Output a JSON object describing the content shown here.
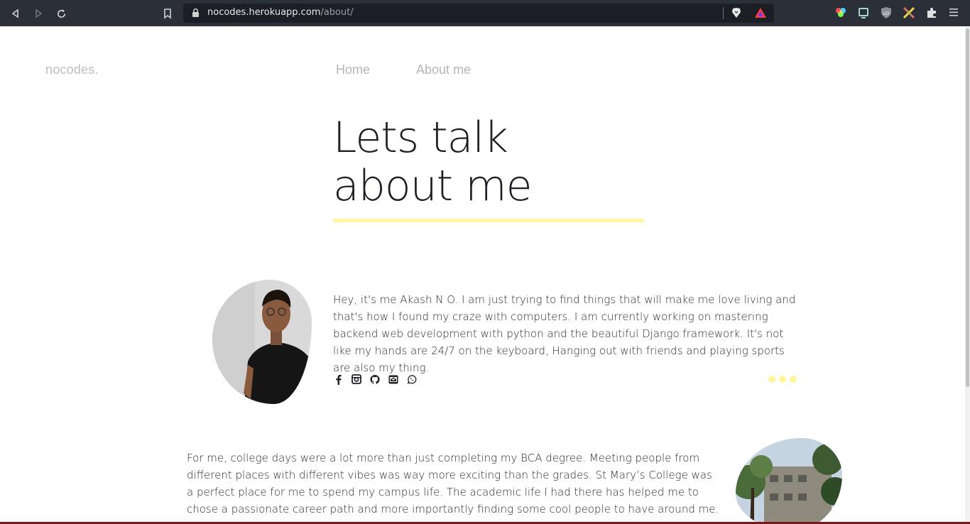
{
  "browser": {
    "url_host": "nocodes.herokuapp.com",
    "url_path": "/about/"
  },
  "site": {
    "logo": "nocodes.",
    "nav": [
      {
        "label": "Home"
      },
      {
        "label": "About me"
      }
    ]
  },
  "hero": {
    "line1": "Lets talk",
    "line2": "about me"
  },
  "about": {
    "bio": "Hey, it's me Akash N O. I am just trying to find things that will make me love living and that's how I found my craze with computers. I am currently working on mastering backend web development with python and the beautiful Django framework. It's not like my hands are 24/7 on the keyboard, Hanging out with friends and playing sports are also my thing.",
    "socials": [
      "facebook-icon",
      "instagram-icon",
      "github-icon",
      "email-icon",
      "whatsapp-icon"
    ]
  },
  "college": {
    "text": "For me, college days were a lot more than just completing my BCA degree. Meeting people from different places with different vibes was way more exciting than the grades. St Mary’s College was a perfect place for me to spend my campus life. The academic life I had there has helped me to chose a passionate career path and more importantly finding some cool people to have around me."
  },
  "colors": {
    "accent_yellow": "#fff59d",
    "text_dark": "#1e1e24",
    "nav_gray": "#b5b5b5",
    "chrome_bg": "#2b2f37"
  }
}
